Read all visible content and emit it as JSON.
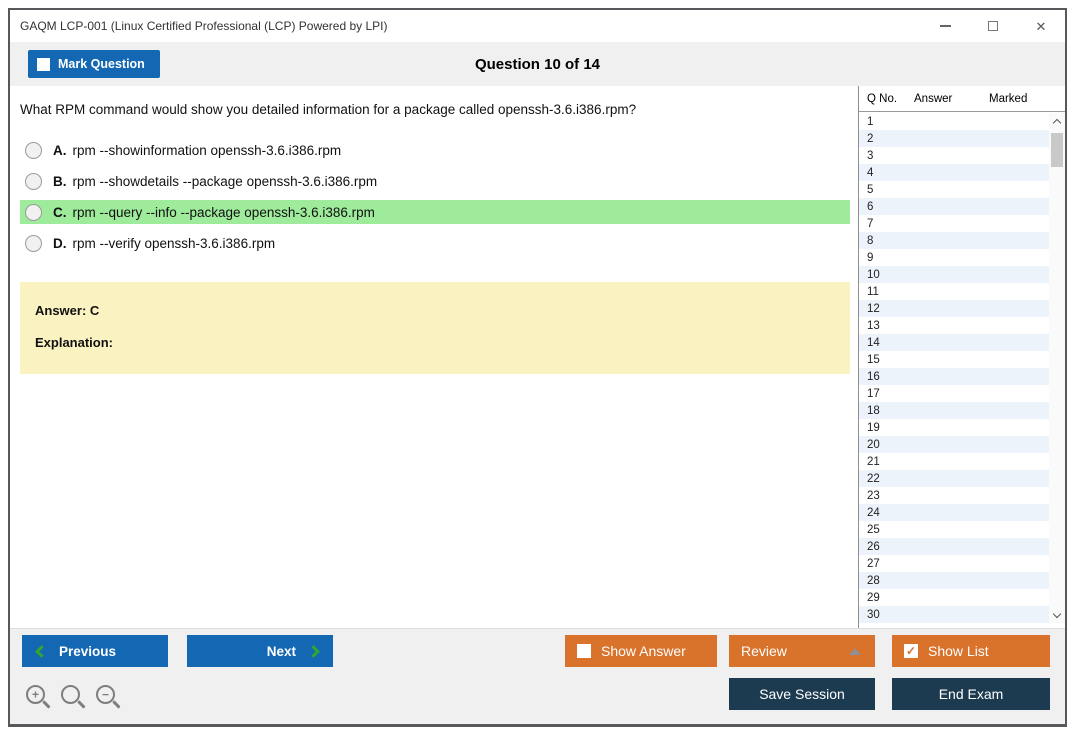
{
  "window": {
    "title": "GAQM LCP-001 (Linux Certified Professional (LCP) Powered by LPI)"
  },
  "header": {
    "mark_question_label": "Mark Question",
    "question_counter": "Question 10 of 14"
  },
  "question": {
    "text": "What RPM command would show you detailed information for a package called openssh-3.6.i386.rpm?",
    "options": [
      {
        "letter": "A.",
        "text": "rpm --showinformation openssh-3.6.i386.rpm",
        "highlighted": false
      },
      {
        "letter": "B.",
        "text": "rpm --showdetails --package openssh-3.6.i386.rpm",
        "highlighted": false
      },
      {
        "letter": "C.",
        "text": "rpm --query --info --package openssh-3.6.i386.rpm",
        "highlighted": true
      },
      {
        "letter": "D.",
        "text": "rpm --verify openssh-3.6.i386.rpm",
        "highlighted": false
      }
    ],
    "answer_label": "Answer: C",
    "explanation_label": "Explanation:"
  },
  "question_list": {
    "columns": {
      "q_no": "Q No.",
      "answer": "Answer",
      "marked": "Marked"
    },
    "rows": [
      1,
      2,
      3,
      4,
      5,
      6,
      7,
      8,
      9,
      10,
      11,
      12,
      13,
      14,
      15,
      16,
      17,
      18,
      19,
      20,
      21,
      22,
      23,
      24,
      25,
      26,
      27,
      28,
      29,
      30
    ]
  },
  "footer": {
    "previous_label": "Previous",
    "next_label": "Next",
    "show_answer_label": "Show Answer",
    "review_label": "Review",
    "show_list_label": "Show List",
    "save_session_label": "Save Session",
    "end_exam_label": "End Exam"
  },
  "icons": {
    "close": "✕",
    "check": "✓",
    "zoom_in_sign": "+",
    "zoom_out_sign": "−"
  },
  "colors": {
    "accent_blue": "#1467b2",
    "accent_orange": "#d9722b",
    "accent_navy": "#1c3b50",
    "highlight_green": "#9eeb9c",
    "answer_yellow": "#faf3c1",
    "row_alt_blue": "#edf3fa",
    "chevron_green": "#2fa832"
  }
}
